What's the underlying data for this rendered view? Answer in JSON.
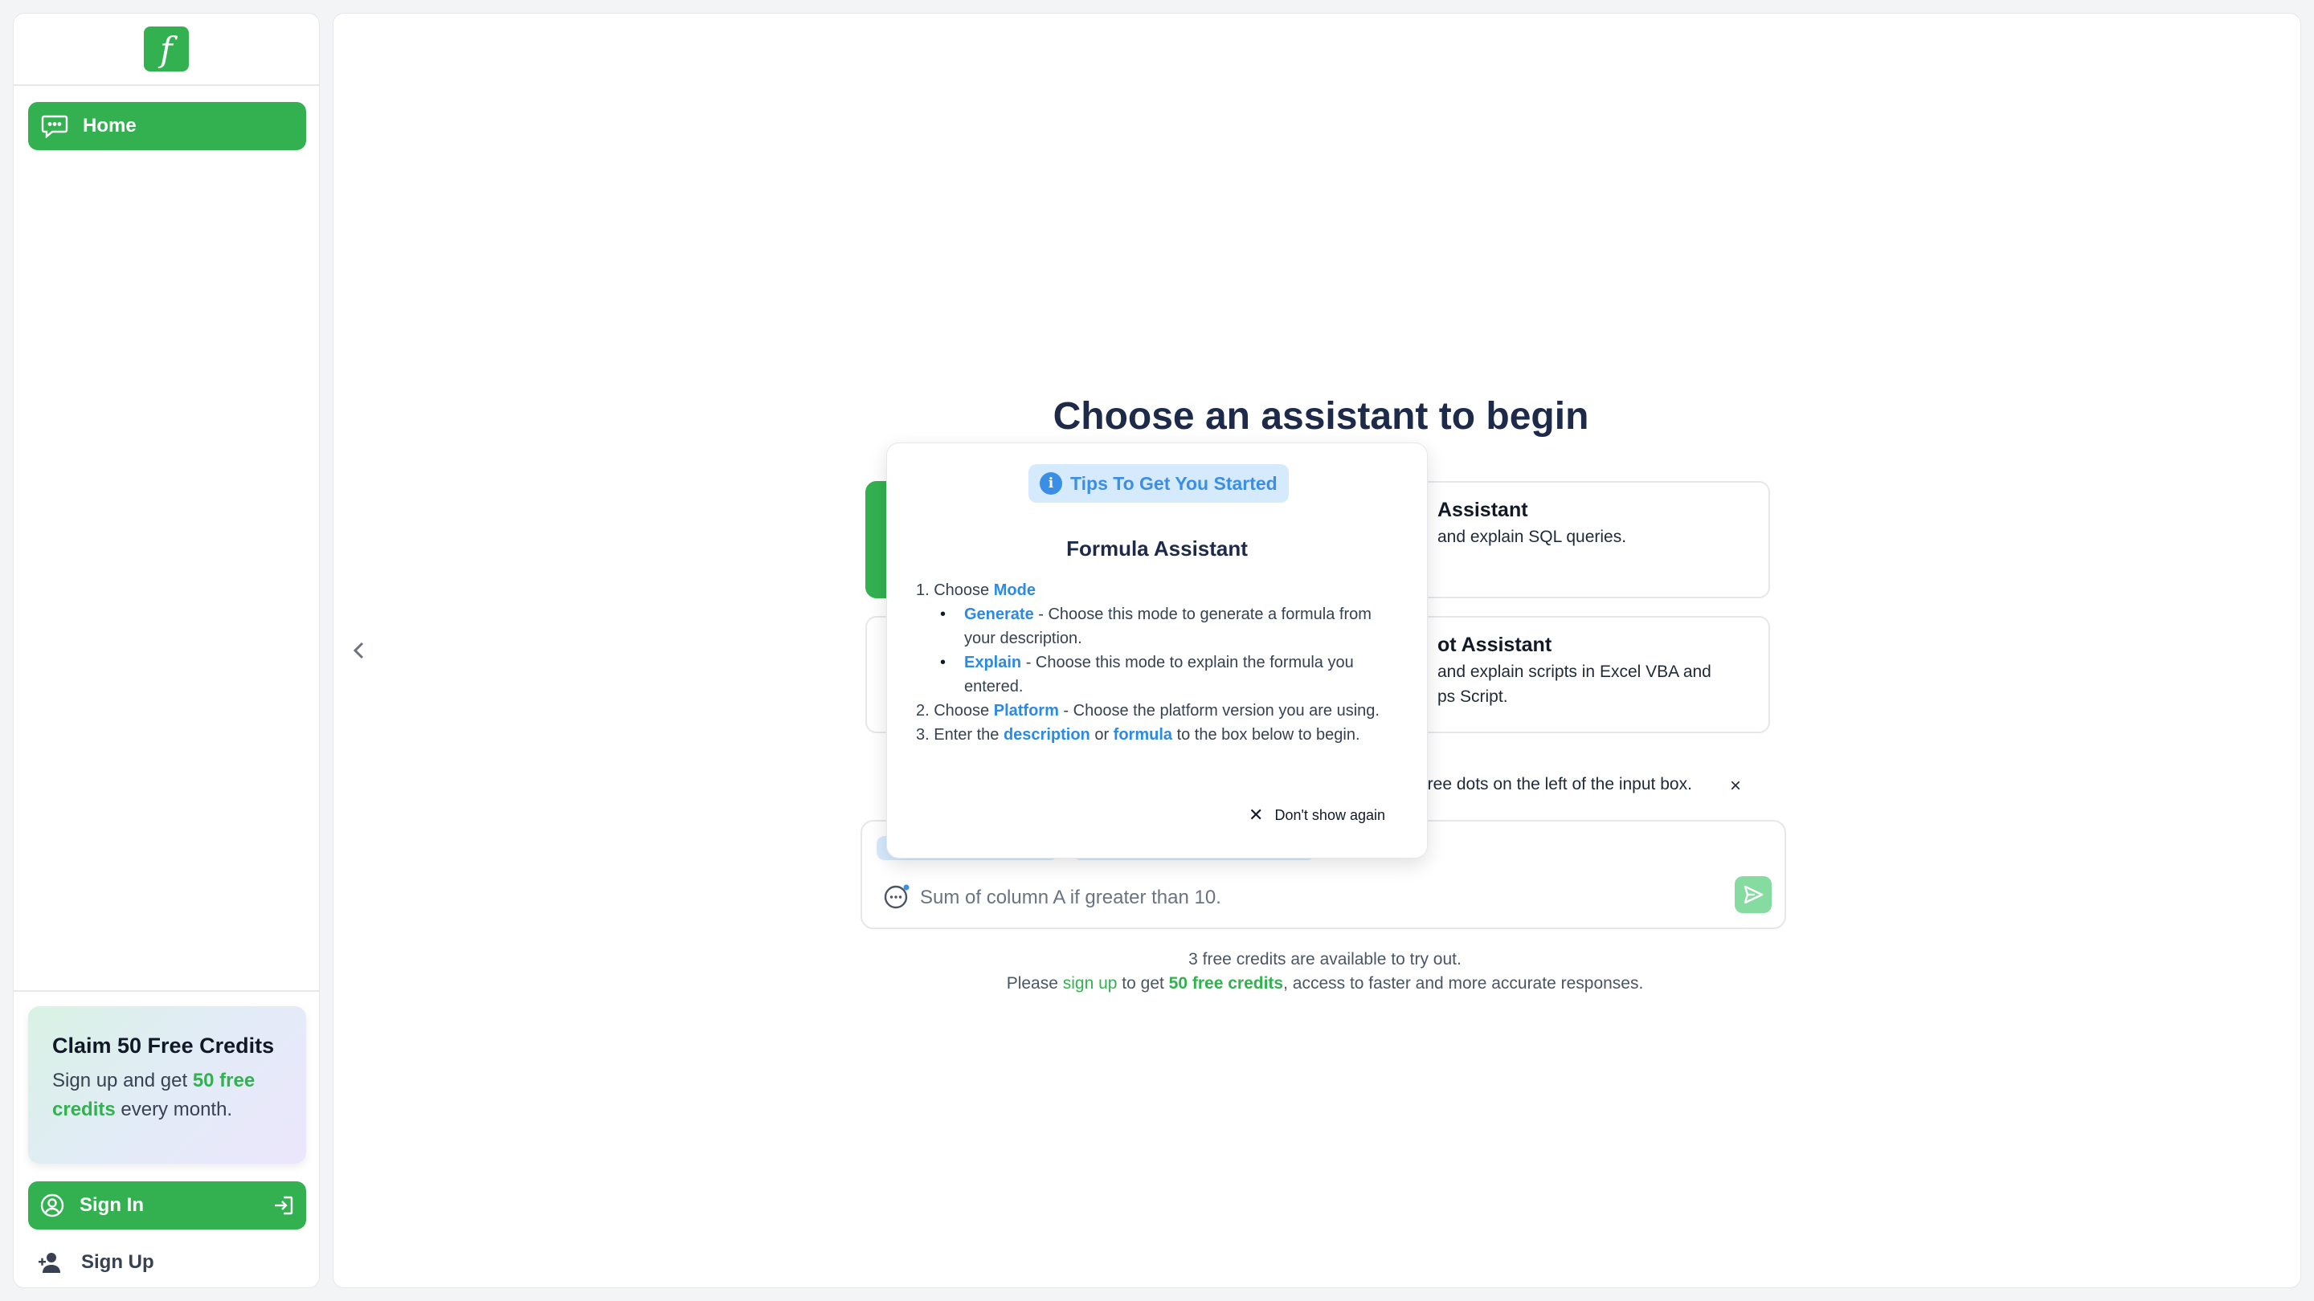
{
  "sidebar": {
    "logo_letter": "f",
    "nav": {
      "home_label": "Home"
    },
    "promo": {
      "title": "Claim 50 Free Credits",
      "text_before": "Sign up and get ",
      "highlight": "50 free credits",
      "text_after": " every month."
    },
    "signin_label": "Sign In",
    "signup_label": "Sign Up"
  },
  "main": {
    "title": "Choose an assistant to begin",
    "cards": [
      {
        "title": "Assistant",
        "desc": "and explain SQL queries."
      },
      {
        "title": "ot Assistant",
        "desc_line1": "and explain scripts in Excel VBA and",
        "desc_line2": "ps Script."
      }
    ],
    "hint": "hree dots on the left of the input box.",
    "hint_close": "×",
    "input": {
      "placeholder": "Sum of column A if greater than 10."
    },
    "credits_line1": "3 free credits are available to try out.",
    "credits_line2": {
      "before": "Please ",
      "link": "sign up",
      "middle": " to get ",
      "bold": "50 free credits",
      "after": ", access to faster and more accurate responses."
    }
  },
  "popup": {
    "badge": "Tips To Get You Started",
    "title": "Formula Assistant",
    "step1_prefix": "1. Choose ",
    "step1_kw": "Mode",
    "generate_kw": "Generate",
    "generate_text": " - Choose this mode to generate a formula from your description.",
    "explain_kw": "Explain",
    "explain_text": " - Choose this mode to explain the formula you entered.",
    "step2_prefix": "2. Choose ",
    "step2_kw": "Platform",
    "step2_text": " - Choose the platform version you are using.",
    "step3_prefix": "3. Enter the ",
    "step3_kw1": "description",
    "step3_or": " or ",
    "step3_kw2": "formula",
    "step3_text": " to the box below to begin.",
    "dont_show": "Don't show again"
  },
  "colors": {
    "brand_green": "#33b150",
    "accent_blue": "#2a8ae6",
    "chip_blue": "#d6eafe"
  },
  "icons": [
    "chat-icon",
    "user-circle-icon",
    "sign-in-arrow-icon",
    "user-plus-icon",
    "chevron-left-icon",
    "dots-circle-icon",
    "send-icon",
    "info-icon",
    "close-icon"
  ]
}
